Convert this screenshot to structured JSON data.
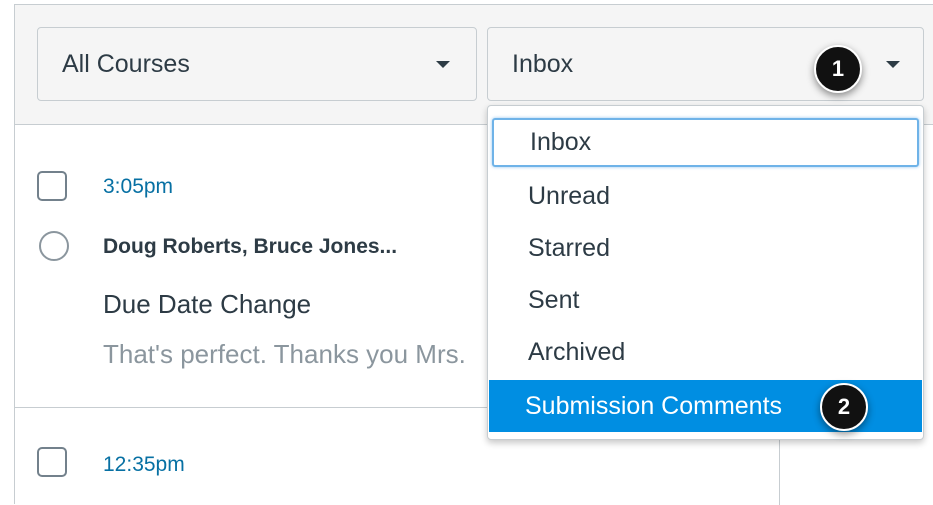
{
  "filters": {
    "course": {
      "selected": "All Courses",
      "icon": "caret-down-icon"
    },
    "mailbox": {
      "selected": "Inbox",
      "icon": "caret-down-icon"
    }
  },
  "callouts": [
    "1",
    "2"
  ],
  "mailbox_menu": {
    "options": [
      "Inbox",
      "Unread",
      "Starred",
      "Sent",
      "Archived",
      "Submission Comments"
    ],
    "focused": "Inbox",
    "highlighted": "Submission Comments"
  },
  "messages": [
    {
      "time": "3:05pm",
      "from": "Doug Roberts, Bruce Jones...",
      "subject": "Due Date Change",
      "preview": "That's perfect. Thanks you Mrs. Jones"
    },
    {
      "time": "12:35pm"
    }
  ],
  "colors": {
    "accent": "#008ee2",
    "link": "#0770a3",
    "text": "#2d3b45",
    "muted": "#8b969e",
    "toolbar_bg": "#f5f5f5",
    "border": "#c7cdd1"
  }
}
